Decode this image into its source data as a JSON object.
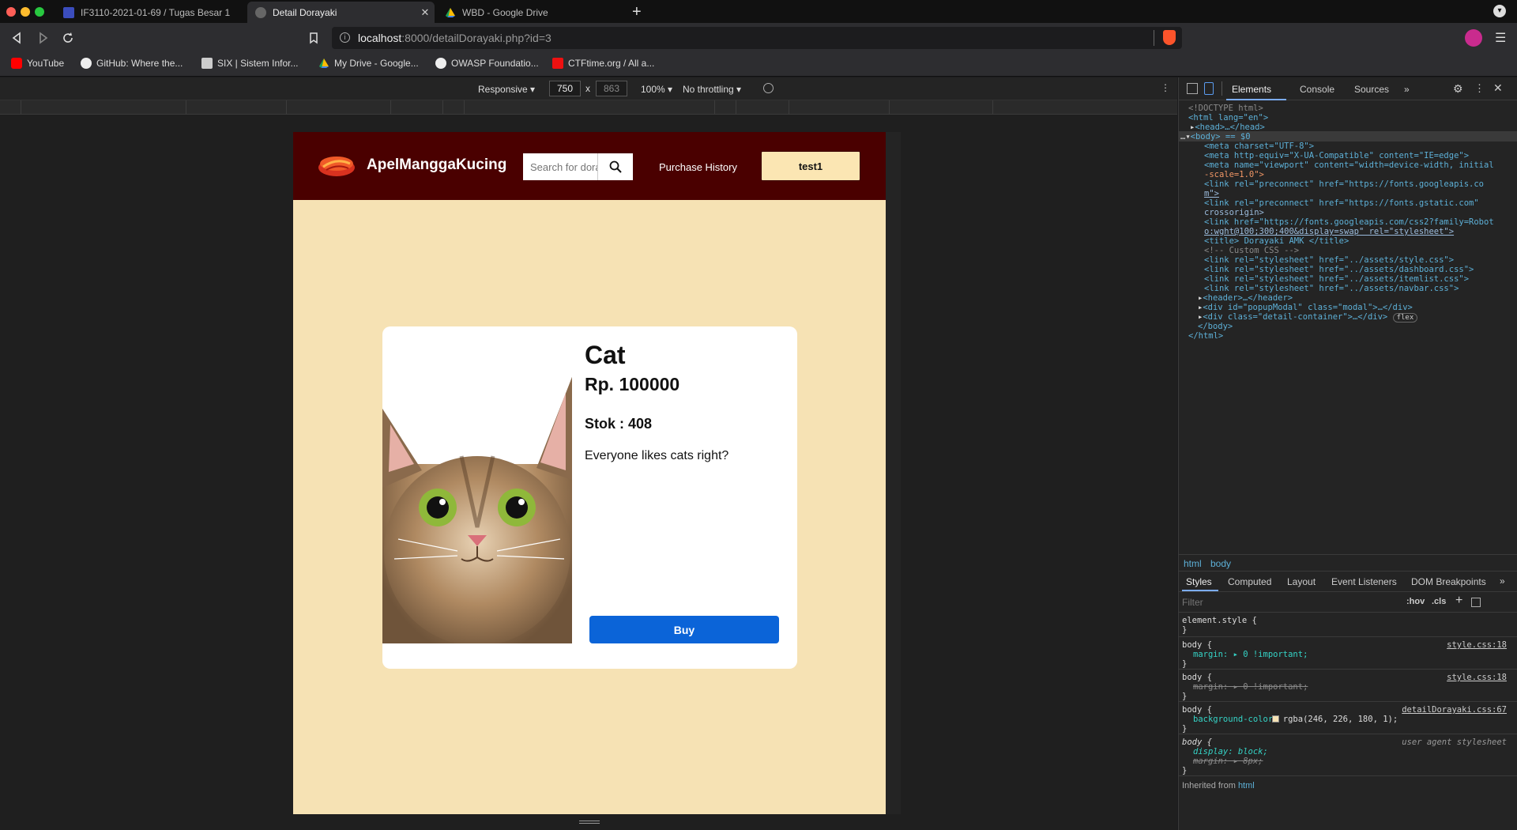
{
  "browser": {
    "tabs": [
      {
        "title": "IF3110-2021-01-69 / Tugas Besar 1",
        "active": false
      },
      {
        "title": "Detail Dorayaki",
        "active": true
      },
      {
        "title": "WBD - Google Drive",
        "active": false
      }
    ],
    "new_tab": "+",
    "url_host": "localhost",
    "url_rest": ":8000/detailDorayaki.php?id=3",
    "bookmarks": [
      "YouTube",
      "GitHub: Where the...",
      "SIX | Sistem Infor...",
      "My Drive - Google...",
      "OWASP Foundatio...",
      "CTFtime.org / All a..."
    ]
  },
  "device_toolbar": {
    "mode": "Responsive",
    "width": "750",
    "times": "x",
    "height": "863",
    "zoom": "100%",
    "throttle": "No throttling"
  },
  "site": {
    "brand": "ApelManggaKucing",
    "search_placeholder": "Search for dorayaki",
    "nav_history": "Purchase History",
    "user": "test1",
    "product": {
      "name": "Cat",
      "price": "Rp. 100000",
      "stock": "Stok : 408",
      "description": "Everyone likes cats right?",
      "buy_label": "Buy"
    }
  },
  "devtools": {
    "tabs": [
      "Elements",
      "Console",
      "Sources",
      "»"
    ],
    "breadcrumbs": [
      "html",
      "body"
    ],
    "styles_tabs": [
      "Styles",
      "Computed",
      "Layout",
      "Event Listeners",
      "DOM Breakpoints",
      "»"
    ],
    "filter_placeholder": "Filter",
    "filter_hov": ":hov",
    "filter_cls": ".cls",
    "dom_lines": {
      "doctype": "<!DOCTYPE html>",
      "html_open": "<html lang=\"en\">",
      "head": "<head>…</head>",
      "body_open": "<body> == $0",
      "meta_charset": "<meta charset=\"UTF-8\">",
      "meta_compat": "<meta http-equiv=\"X-UA-Compatible\" content=\"IE=edge\">",
      "meta_viewport_1": "<meta name=\"viewport\" content=\"width=device-width, initial",
      "meta_viewport_2": "-scale=1.0\">",
      "link_pre1_a": "<link rel=\"preconnect\" href=\"https://fonts.googleapis.co",
      "link_pre1_b": "m\">",
      "link_pre2_a": "<link rel=\"preconnect\" href=\"https://fonts.gstatic.com\"",
      "link_pre2_b": "crossorigin>",
      "link_font_a": "<link href=\"https://fonts.googleapis.com/css2?family=Robot",
      "link_font_b": "o:wght@100;300;400&display=swap\" rel=\"stylesheet\">",
      "title": "<title> Dorayaki AMK </title>",
      "comment": "<!-- Custom CSS -->",
      "css1": "<link rel=\"stylesheet\" href=\"../assets/style.css\">",
      "css2": "<link rel=\"stylesheet\" href=\"../assets/dashboard.css\">",
      "css3": "<link rel=\"stylesheet\" href=\"../assets/itemlist.css\">",
      "css4": "<link rel=\"stylesheet\" href=\"../assets/navbar.css\">",
      "header": "<header>…</header>",
      "modal": "<div id=\"popupModal\" class=\"modal\">…</div>",
      "detail": "<div class=\"detail-container\">…</div>",
      "flex_badge": "flex",
      "body_close": "</body>",
      "html_close": "</html>"
    },
    "rules": [
      {
        "selector": "element.style {",
        "source": "",
        "decl": "",
        "close": "}"
      },
      {
        "selector": "body {",
        "source": "style.css:18",
        "decl": "margin: ▸ 0 !important;",
        "close": "}"
      },
      {
        "selector": "body {",
        "source": "style.css:18",
        "decl": "margin: ▸ 0 !important;",
        "close": "}"
      },
      {
        "selector": "body {",
        "source": "detailDorayaki.css:67",
        "decl": "background-color: rgba(246, 226, 180, 1);",
        "close": "}"
      },
      {
        "selector": "body {",
        "source": "user agent stylesheet",
        "decl": "display: block;",
        "decl2": "margin: ▸ 8px;",
        "close": "}"
      }
    ],
    "inherited": "Inherited from",
    "inherited_tag": "html"
  }
}
